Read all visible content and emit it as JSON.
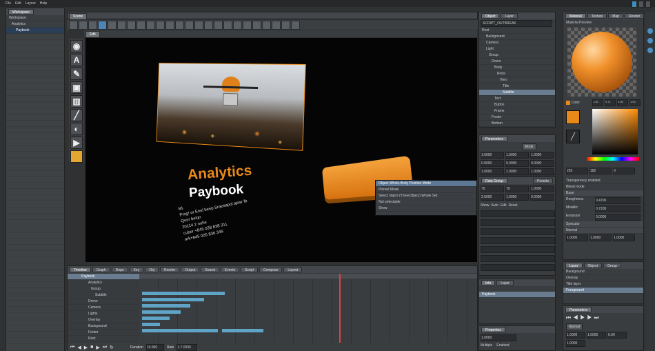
{
  "menubar": {
    "items": [
      "File",
      "Edit",
      "Layout",
      "Help"
    ]
  },
  "left_panel": {
    "tab": "Workspace",
    "tree": [
      "Workspace",
      "Analytics",
      "Paybook"
    ],
    "selected_index": 2
  },
  "viewport": {
    "header_tab": "Scene",
    "sub_tab": "Edit",
    "title_line1": "Analytics",
    "title_line2": "Paybook",
    "body_lines": [
      "Ml.",
      "Prog! or Enel beep Sraesapol apisr fb",
      "Quer beiqn",
      "20114 2 nuhe",
      "cuber +845 028 838 311",
      "ark+845 026 836 349"
    ]
  },
  "context_menu": {
    "items": [
      "Object Whole-Body Position Mode",
      "Pinned Mode",
      "Select object (ThreeObject) Whole Set",
      "Not selectable",
      "Show"
    ]
  },
  "outliner": {
    "tabs": [
      "Object",
      "Layer"
    ],
    "dropdown": "SCRIPT_OUTBREAK",
    "items": [
      "Root",
      "Background",
      "Camera",
      "Light",
      "Group",
      "Drone",
      "Body",
      "Rotor",
      "Hero",
      "Title",
      "Subtitle",
      "Text",
      "Button",
      "Frame",
      "Footer",
      "Bottom"
    ],
    "selected_index": 10
  },
  "parameters": {
    "title": "Parameters",
    "values": [
      "1.0000",
      "1.0000",
      "1.0000",
      "0.0000",
      "0.0000",
      "0.0000",
      "1.0000",
      "1.0000",
      "1.0000"
    ],
    "mode": "Mode"
  },
  "data_group": {
    "title": "Data Group",
    "label": "Presets",
    "values": [
      "70",
      "70",
      "1.0000",
      "2.0000",
      "1.0000",
      "0.0000"
    ],
    "checks": [
      "Show",
      "Auto",
      "Edit",
      "Reset"
    ]
  },
  "material": {
    "tabs": [
      "Material",
      "Texture",
      "Map",
      "Render"
    ],
    "preview_label": "Material Preview",
    "color_label": "Color",
    "color_values": [
      "1.00",
      "0.71",
      "0.00",
      "1.00"
    ],
    "rgb_values": [
      "255",
      "182",
      "0"
    ],
    "transparency": "Transparency enabled",
    "blend": "Blend mode",
    "sections": [
      "Base",
      "Specular",
      "Normal"
    ],
    "fields": [
      "Roughness",
      "Metallic",
      "Emission"
    ],
    "field_values": [
      "0.4700",
      "0.7200",
      "0.0000"
    ],
    "normal_values": [
      "1.0000",
      "1.0000",
      "1.0000"
    ]
  },
  "layers_panel": {
    "tabs": [
      "Layer",
      "Object",
      "Group"
    ],
    "items": [
      "Background",
      "Overlay",
      "Title layer",
      "Foreground"
    ]
  },
  "params_bottom": {
    "title": "Parameters",
    "mode": "Normal",
    "values": [
      "1.0000",
      "1.0000",
      "0.00",
      "1.0000"
    ]
  },
  "props_bottom": {
    "title": "Properties",
    "value": "1.0000",
    "checks": [
      "Multiple",
      "Enabled"
    ]
  },
  "transform_small": {
    "tabs": [
      "Info",
      "Layer"
    ],
    "item": "Paybook"
  },
  "timeline": {
    "tabs": [
      "Timeline",
      "Graph",
      "Dope",
      "Key",
      "Obj",
      "Render",
      "Output",
      "Sound",
      "Events",
      "Script",
      "Compose",
      "Layout"
    ],
    "tracks": [
      "Paybook",
      "Analytics",
      "Group",
      "Subtitle",
      "Drone",
      "Camera",
      "Lights",
      "Overlay",
      "Background",
      "Footer",
      "Root"
    ],
    "frame_label": "Duration",
    "frame_value": "10.000",
    "rate_label": "Rate",
    "rate_value": "1.7.0000"
  },
  "colors": {
    "accent": "#e8891a",
    "highlight": "#6a7c90",
    "track": "#5fa3c7"
  }
}
